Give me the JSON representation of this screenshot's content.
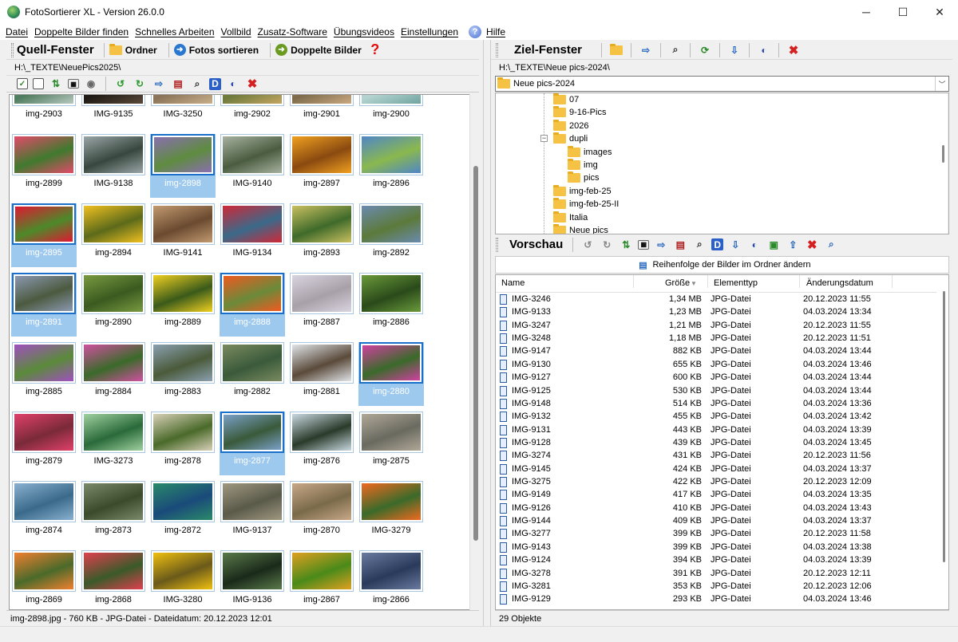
{
  "window": {
    "title": "FotoSortierer XL - Version 26.0.0",
    "minimize": "─",
    "maximize": "☐",
    "close": "✕"
  },
  "menu": [
    "Datei",
    "Doppelte Bilder finden",
    "Schnelles Arbeiten",
    "Vollbild",
    "Zusatz-Software",
    "Übungsvideos",
    "Einstellungen",
    "Hilfe"
  ],
  "left": {
    "title": "Quell-Fenster",
    "buttons": {
      "ordner": "Ordner",
      "sortieren": "Fotos sortieren",
      "doppelte": "Doppelte Bilder"
    },
    "path": "H:\\_TEXTE\\NeuePics2025\\",
    "thumbs": [
      {
        "name": "img-2903",
        "colors": [
          "#4d7a5c",
          "#b8c9c0"
        ]
      },
      {
        "name": "IMG-9135",
        "colors": [
          "#1f1a14",
          "#5a4a3a"
        ]
      },
      {
        "name": "IMG-3250",
        "colors": [
          "#8a7258",
          "#c9b08a"
        ]
      },
      {
        "name": "img-2902",
        "colors": [
          "#6c7a3c",
          "#c5a662"
        ]
      },
      {
        "name": "img-2901",
        "colors": [
          "#7e6a4a",
          "#c9aa82"
        ]
      },
      {
        "name": "img-2900",
        "colors": [
          "#b5d4d0",
          "#6fa4a0"
        ]
      },
      {
        "name": "img-2899",
        "colors": [
          "#3f7a2e",
          "#e34a6a"
        ]
      },
      {
        "name": "IMG-9138",
        "colors": [
          "#38473e",
          "#9aa6a8"
        ]
      },
      {
        "name": "img-2898",
        "colors": [
          "#5e8c3f",
          "#8a6eb0"
        ],
        "selected": true
      },
      {
        "name": "IMG-9140",
        "colors": [
          "#4a5c40",
          "#a7b2a0"
        ]
      },
      {
        "name": "img-2897",
        "colors": [
          "#8a4a10",
          "#f0a020"
        ]
      },
      {
        "name": "img-2896",
        "colors": [
          "#8ab84e",
          "#4f86c8"
        ]
      },
      {
        "name": "img-2895",
        "colors": [
          "#4c8a2a",
          "#e01832"
        ],
        "selected": true
      },
      {
        "name": "img-2894",
        "colors": [
          "#5c6a1a",
          "#f0c020"
        ]
      },
      {
        "name": "IMG-9141",
        "colors": [
          "#6a4a30",
          "#c29a70"
        ]
      },
      {
        "name": "IMG-9134",
        "colors": [
          "#3a6a8a",
          "#d02838"
        ]
      },
      {
        "name": "img-2893",
        "colors": [
          "#3f6a2a",
          "#c9c060"
        ]
      },
      {
        "name": "img-2892",
        "colors": [
          "#5c7a3a",
          "#6a8ab0"
        ]
      },
      {
        "name": "img-2891",
        "colors": [
          "#4c5a40",
          "#8a98b0"
        ],
        "selected": true
      },
      {
        "name": "img-2890",
        "colors": [
          "#3a5a20",
          "#7a9a40"
        ]
      },
      {
        "name": "img-2889",
        "colors": [
          "#3a5a1a",
          "#f0d020"
        ]
      },
      {
        "name": "img-2888",
        "colors": [
          "#6a8a3a",
          "#f05a20"
        ],
        "selected": true
      },
      {
        "name": "img-2887",
        "colors": [
          "#a8a0a8",
          "#d8d4e0"
        ]
      },
      {
        "name": "img-2886",
        "colors": [
          "#2a4a1a",
          "#6a9a3a"
        ]
      },
      {
        "name": "img-2885",
        "colors": [
          "#5a8a3a",
          "#a050c0"
        ]
      },
      {
        "name": "img-2884",
        "colors": [
          "#3a6a2a",
          "#d050a0"
        ]
      },
      {
        "name": "img-2883",
        "colors": [
          "#4a5a3a",
          "#8aa0b0"
        ]
      },
      {
        "name": "img-2882",
        "colors": [
          "#3a5a3a",
          "#7a8a60"
        ]
      },
      {
        "name": "img-2881",
        "colors": [
          "#5a4a3a",
          "#e0e4e8"
        ]
      },
      {
        "name": "img-2880",
        "colors": [
          "#3a6a2a",
          "#d040a0"
        ],
        "selected": true
      },
      {
        "name": "img-2879",
        "colors": [
          "#7a2a3a",
          "#e0406a"
        ]
      },
      {
        "name": "IMG-3273",
        "colors": [
          "#2a6a3a",
          "#a0d0a0"
        ]
      },
      {
        "name": "img-2878",
        "colors": [
          "#4a6a2a",
          "#d8d0b8"
        ]
      },
      {
        "name": "img-2877",
        "colors": [
          "#3a5a3a",
          "#7aa0c8"
        ],
        "selected": true
      },
      {
        "name": "img-2876",
        "colors": [
          "#2a3a2a",
          "#c8d8e0"
        ]
      },
      {
        "name": "img-2875",
        "colors": [
          "#6a6a60",
          "#b0a898"
        ]
      },
      {
        "name": "img-2874",
        "colors": [
          "#3a6a8a",
          "#8ab0d0"
        ]
      },
      {
        "name": "img-2873",
        "colors": [
          "#3a4a2a",
          "#7a8a6a"
        ]
      },
      {
        "name": "img-2872",
        "colors": [
          "#1a4a7a",
          "#2a8a6a"
        ]
      },
      {
        "name": "IMG-9137",
        "colors": [
          "#5a5a4a",
          "#a09880"
        ]
      },
      {
        "name": "img-2870",
        "colors": [
          "#7a6a4a",
          "#c8a888"
        ]
      },
      {
        "name": "IMG-3279",
        "colors": [
          "#3a6a2a",
          "#f06a20"
        ]
      },
      {
        "name": "img-2869",
        "colors": [
          "#4a6a2a",
          "#f08030"
        ]
      },
      {
        "name": "img-2868",
        "colors": [
          "#3a5a2a",
          "#e04050"
        ]
      },
      {
        "name": "IMG-3280",
        "colors": [
          "#6a5a1a",
          "#f0c010"
        ]
      },
      {
        "name": "IMG-9136",
        "colors": [
          "#1a2a1a",
          "#5a7a4a"
        ]
      },
      {
        "name": "img-2867",
        "colors": [
          "#4a8a1a",
          "#e0a020"
        ]
      },
      {
        "name": "img-2866",
        "colors": [
          "#2a3a5a",
          "#6a7aa0"
        ]
      }
    ],
    "status": "img-2898.jpg - 760 KB - JPG-Datei - Dateidatum: 20.12.2023 12:01"
  },
  "right": {
    "title": "Ziel-Fenster",
    "path": "H:\\_TEXTE\\Neue pics-2024\\",
    "dropdown": "Neue pics-2024",
    "tree": [
      {
        "label": "07",
        "level": 1
      },
      {
        "label": "9-16-Pics",
        "level": 1
      },
      {
        "label": "2026",
        "level": 1
      },
      {
        "label": "dupli",
        "level": 1,
        "expander": "−"
      },
      {
        "label": "images",
        "level": 2
      },
      {
        "label": "img",
        "level": 2
      },
      {
        "label": "pics",
        "level": 2
      },
      {
        "label": "img-feb-25",
        "level": 1
      },
      {
        "label": "img-feb-25-II",
        "level": 1
      },
      {
        "label": "Italia",
        "level": 1
      },
      {
        "label": "Neue pics",
        "level": 1
      }
    ],
    "preview_title": "Vorschau",
    "order_button": "Reihenfolge der Bilder im Ordner ändern",
    "columns": {
      "name": "Name",
      "size": "Größe",
      "type": "Elementtyp",
      "date": "Änderungsdatum"
    },
    "files": [
      {
        "name": "IMG-3246",
        "size": "1,34 MB",
        "type": "JPG-Datei",
        "date": "20.12.2023 11:55"
      },
      {
        "name": "IMG-9133",
        "size": "1,23 MB",
        "type": "JPG-Datei",
        "date": "04.03.2024 13:34"
      },
      {
        "name": "IMG-3247",
        "size": "1,21 MB",
        "type": "JPG-Datei",
        "date": "20.12.2023 11:55"
      },
      {
        "name": "IMG-3248",
        "size": "1,18 MB",
        "type": "JPG-Datei",
        "date": "20.12.2023 11:51"
      },
      {
        "name": "IMG-9147",
        "size": "882 KB",
        "type": "JPG-Datei",
        "date": "04.03.2024 13:44"
      },
      {
        "name": "IMG-9130",
        "size": "655 KB",
        "type": "JPG-Datei",
        "date": "04.03.2024 13:46"
      },
      {
        "name": "IMG-9127",
        "size": "600 KB",
        "type": "JPG-Datei",
        "date": "04.03.2024 13:44"
      },
      {
        "name": "IMG-9125",
        "size": "530 KB",
        "type": "JPG-Datei",
        "date": "04.03.2024 13:44"
      },
      {
        "name": "IMG-9148",
        "size": "514 KB",
        "type": "JPG-Datei",
        "date": "04.03.2024 13:36"
      },
      {
        "name": "IMG-9132",
        "size": "455 KB",
        "type": "JPG-Datei",
        "date": "04.03.2024 13:42"
      },
      {
        "name": "IMG-9131",
        "size": "443 KB",
        "type": "JPG-Datei",
        "date": "04.03.2024 13:39"
      },
      {
        "name": "IMG-9128",
        "size": "439 KB",
        "type": "JPG-Datei",
        "date": "04.03.2024 13:45"
      },
      {
        "name": "IMG-3274",
        "size": "431 KB",
        "type": "JPG-Datei",
        "date": "20.12.2023 11:56"
      },
      {
        "name": "IMG-9145",
        "size": "424 KB",
        "type": "JPG-Datei",
        "date": "04.03.2024 13:37"
      },
      {
        "name": "IMG-3275",
        "size": "422 KB",
        "type": "JPG-Datei",
        "date": "20.12.2023 12:09"
      },
      {
        "name": "IMG-9149",
        "size": "417 KB",
        "type": "JPG-Datei",
        "date": "04.03.2024 13:35"
      },
      {
        "name": "IMG-9126",
        "size": "410 KB",
        "type": "JPG-Datei",
        "date": "04.03.2024 13:43"
      },
      {
        "name": "IMG-9144",
        "size": "409 KB",
        "type": "JPG-Datei",
        "date": "04.03.2024 13:37"
      },
      {
        "name": "IMG-3277",
        "size": "399 KB",
        "type": "JPG-Datei",
        "date": "20.12.2023 11:58"
      },
      {
        "name": "IMG-9143",
        "size": "399 KB",
        "type": "JPG-Datei",
        "date": "04.03.2024 13:38"
      },
      {
        "name": "IMG-9124",
        "size": "394 KB",
        "type": "JPG-Datei",
        "date": "04.03.2024 13:39"
      },
      {
        "name": "IMG-3278",
        "size": "391 KB",
        "type": "JPG-Datei",
        "date": "20.12.2023 12:11"
      },
      {
        "name": "IMG-3281",
        "size": "353 KB",
        "type": "JPG-Datei",
        "date": "20.12.2023 12:06"
      },
      {
        "name": "IMG-9129",
        "size": "293 KB",
        "type": "JPG-Datei",
        "date": "04.03.2024 13:46"
      }
    ],
    "status": "29 Objekte"
  },
  "colors": {
    "selection": "#9ec9ee",
    "selection_border": "#1a70c8",
    "close_red": "#d42020"
  }
}
